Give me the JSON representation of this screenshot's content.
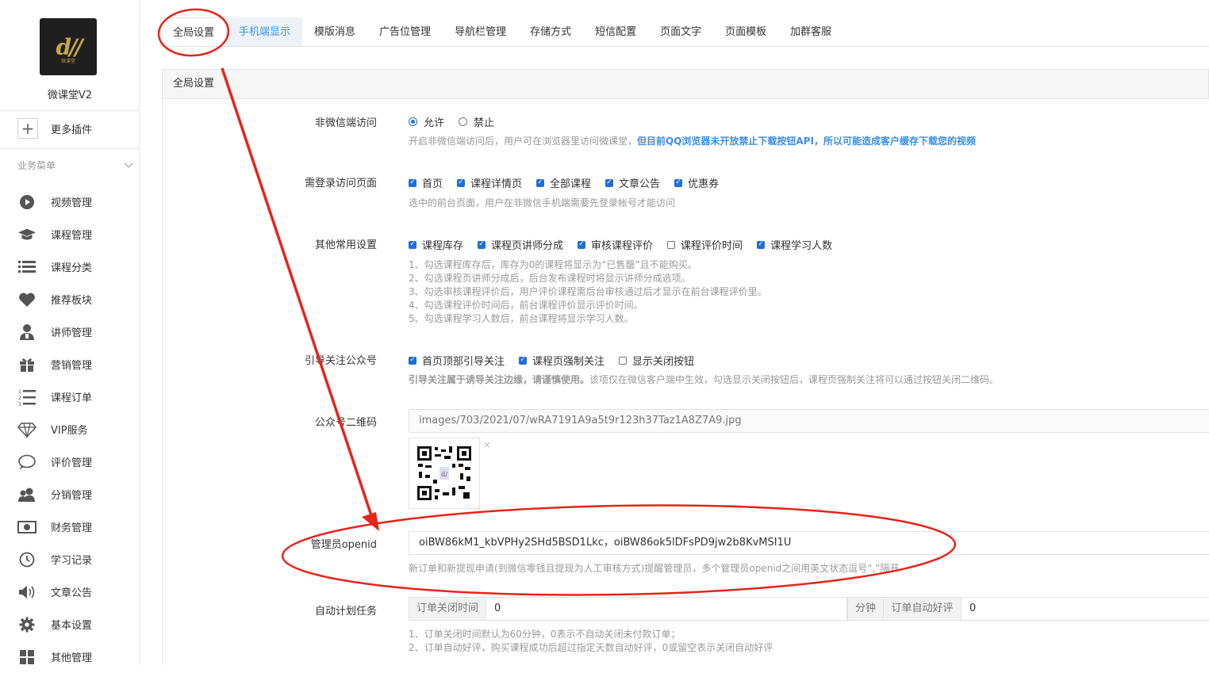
{
  "sidebar": {
    "logo_text": "微课堂",
    "app_name": "微课堂V2",
    "more_plugins": "更多插件",
    "menu_header": "业务菜单",
    "items": [
      {
        "icon": "play-circle-icon",
        "label": "视频管理"
      },
      {
        "icon": "graduation-cap-icon",
        "label": "课程管理"
      },
      {
        "icon": "list-icon",
        "label": "课程分类"
      },
      {
        "icon": "heart-icon",
        "label": "推荐板块"
      },
      {
        "icon": "teacher-icon",
        "label": "讲师管理"
      },
      {
        "icon": "gift-icon",
        "label": "营销管理"
      },
      {
        "icon": "ordered-list-icon",
        "label": "课程订单"
      },
      {
        "icon": "diamond-icon",
        "label": "VIP服务"
      },
      {
        "icon": "comment-icon",
        "label": "评价管理"
      },
      {
        "icon": "users-icon",
        "label": "分销管理"
      },
      {
        "icon": "money-icon",
        "label": "财务管理"
      },
      {
        "icon": "clock-icon",
        "label": "学习记录"
      },
      {
        "icon": "volume-icon",
        "label": "文章公告"
      },
      {
        "icon": "gear-icon",
        "label": "基本设置"
      },
      {
        "icon": "grid-icon",
        "label": "其他管理"
      }
    ]
  },
  "tabs": [
    "全局设置",
    "手机端显示",
    "模版消息",
    "广告位管理",
    "导航栏管理",
    "存储方式",
    "短信配置",
    "页面文字",
    "页面模板",
    "加群客服"
  ],
  "panel": {
    "title": "全局设置",
    "non_wechat": {
      "label": "非微信端访问",
      "options": [
        {
          "label": "允许",
          "checked": true
        },
        {
          "label": "禁止",
          "checked": false
        }
      ],
      "help": "开启非微信端访问后，用户可在浏览器里访问微课堂，",
      "help_bold": "但目前QQ浏览器未开放禁止下载按钮API，所以可能造成客户缓存下载您的视频"
    },
    "login_pages": {
      "label": "需登录访问页面",
      "options": [
        {
          "label": "首页",
          "checked": true
        },
        {
          "label": "课程详情页",
          "checked": true
        },
        {
          "label": "全部课程",
          "checked": true
        },
        {
          "label": "文章公告",
          "checked": true
        },
        {
          "label": "优惠券",
          "checked": true
        }
      ],
      "help": "选中的前台页面，用户在非微信手机端需要先登录帐号才能访问"
    },
    "common": {
      "label": "其他常用设置",
      "options": [
        {
          "label": "课程库存",
          "checked": true
        },
        {
          "label": "课程页讲师分成",
          "checked": true
        },
        {
          "label": "审核课程评价",
          "checked": true
        },
        {
          "label": "课程评价时间",
          "checked": false
        },
        {
          "label": "课程学习人数",
          "checked": true
        }
      ],
      "help_lines": [
        "1、勾选课程库存后，库存为0的课程将显示为“已售罄”且不能购买。",
        "2、勾选课程页讲师分成后，后台发布课程时将显示讲师分成选项。",
        "3、勾选审核课程评价后，用户评价课程需后台审核通过后才显示在前台课程评价里。",
        "4、勾选课程评价时间后，前台课程评价显示评价时间。",
        "5、勾选课程学习人数后，前台课程将显示学习人数。"
      ]
    },
    "follow": {
      "label": "引导关注公众号",
      "options": [
        {
          "label": "首页顶部引导关注",
          "checked": true
        },
        {
          "label": "课程页强制关注",
          "checked": true
        },
        {
          "label": "显示关闭按钮",
          "checked": false
        }
      ],
      "help_bold": "引导关注属于诱导关注边缘，请谨慎使用。",
      "help": "该项仅在微信客户端中生效，勾选显示关闭按钮后，课程页强制关注将可以通过按钮关闭二维码。"
    },
    "qrcode": {
      "label": "公众号二维码",
      "value": "images/703/2021/07/wRA7191A9a5t9r123h37Taz1A8Z7A9.jpg",
      "remove": "×"
    },
    "admin_openid": {
      "label": "管理员openid",
      "value": "oiBW86kM1_kbVPHy2SHd5BSD1Lkc，oiBW86ok5lDFsPD9jw2b8KvMSI1U",
      "help": "新订单和新提现申请(到微信零钱且提现为人工审核方式)提醒管理员，多个管理员openid之间用英文状态逗号“,”隔开"
    },
    "auto_task": {
      "label": "自动计划任务",
      "close_label": "订单关闭时间",
      "close_value": "0",
      "unit": "分钟",
      "review_label": "订单自动好评",
      "review_value": "0",
      "help_lines": [
        "1、订单关闭时间默认为60分钟，0表示不自动关闭未付款订单；",
        "2、订单自动好评，购买课程成功后超过指定天数自动好评，0或留空表示关闭自动好评"
      ]
    }
  },
  "colors": {
    "annotation": "#e8231a",
    "accent": "#1e6fd9",
    "link": "#3a8ee6"
  }
}
